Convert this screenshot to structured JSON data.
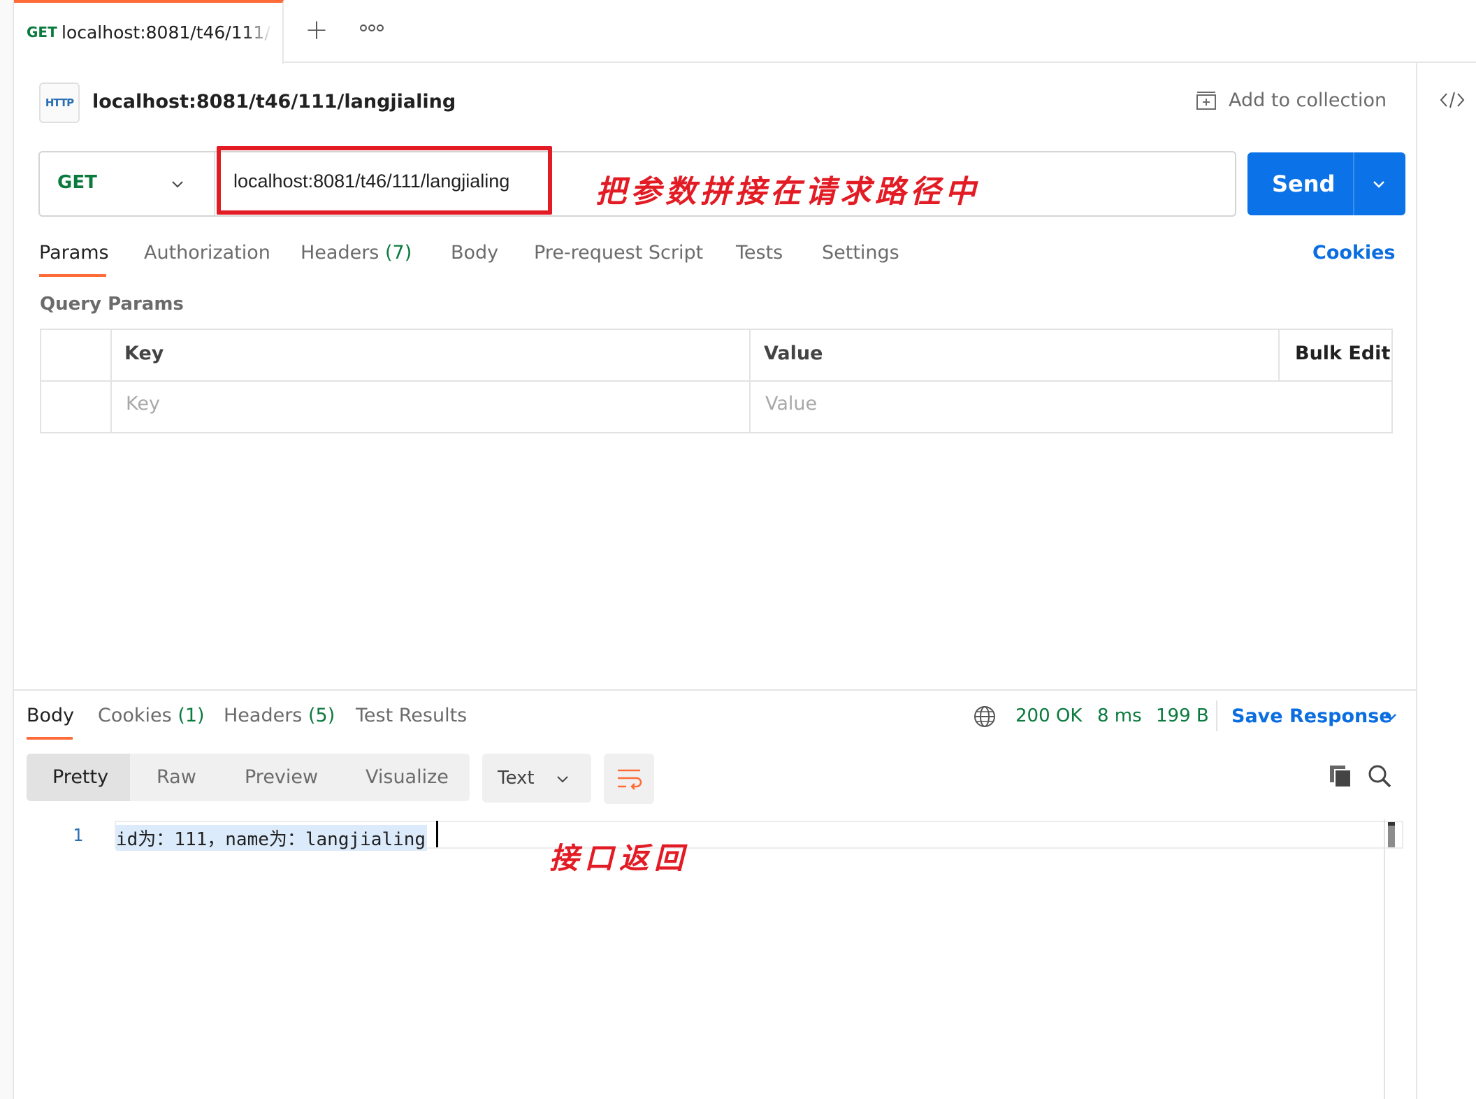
{
  "tab": {
    "method": "GET",
    "url": "localhost:8081/t46/111/langjialing"
  },
  "request": {
    "type_icon_text": "HTTP",
    "title": "localhost:8081/t46/111/langjialing",
    "add_to_collection": "Add to collection",
    "method": "GET",
    "url": "localhost:8081/t46/111/langjialing",
    "send_label": "Send",
    "annotation": "把参数拼接在请求路径中"
  },
  "request_tabs": {
    "params": "Params",
    "authorization": "Authorization",
    "headers": "Headers",
    "headers_count": "(7)",
    "body": "Body",
    "pre_request_script": "Pre-request Script",
    "tests": "Tests",
    "settings": "Settings",
    "cookies": "Cookies"
  },
  "query_params": {
    "title": "Query Params",
    "col_key": "Key",
    "col_value": "Value",
    "bulk_edit": "Bulk Edit",
    "key_placeholder": "Key",
    "value_placeholder": "Value"
  },
  "response_tabs": {
    "body": "Body",
    "cookies": "Cookies",
    "cookies_count": "(1)",
    "headers": "Headers",
    "headers_count": "(5)",
    "test_results": "Test Results"
  },
  "response_status": {
    "code": "200 OK",
    "time": "8 ms",
    "size": "199 B",
    "save_response": "Save Response"
  },
  "format": {
    "pretty": "Pretty",
    "raw": "Raw",
    "preview": "Preview",
    "visualize": "Visualize",
    "type": "Text"
  },
  "response_body": {
    "line_number": "1",
    "content": "id为：111，name为：langjialing",
    "annotation": "接口返回"
  },
  "colors": {
    "accent": "#ff6c37",
    "primary": "#0b72e7",
    "success": "#0b7a3e",
    "annotation": "#e21b24"
  },
  "icons": {
    "add_tab": "plus-icon",
    "more": "more-horizontal-icon",
    "collection": "collection-add-icon",
    "code": "code-icon",
    "globe": "globe-icon",
    "wrap": "wrap-lines-icon",
    "copy": "copy-icon",
    "search": "search-icon"
  }
}
